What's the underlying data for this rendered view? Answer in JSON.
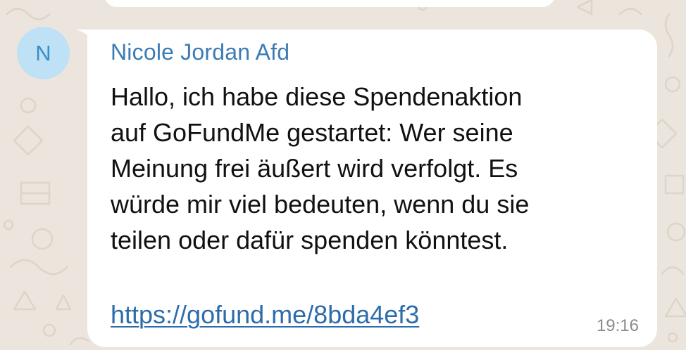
{
  "chat": {
    "background_color": "#ece5dd",
    "bubble_color": "#ffffff"
  },
  "message": {
    "avatar_initial": "N",
    "avatar_bg": "#bfe1f5",
    "avatar_fg": "#3a8ec8",
    "sender_name": "Nicole Jordan Afd",
    "sender_color": "#3c7bb5",
    "text": "Hallo, ich habe diese Spendenaktion\nauf GoFundMe gestartet: Wer seine\nMeinung frei äußert wird verfolgt. Es\nwürde mir viel bedeuten, wenn du sie\nteilen oder dafür spenden könntest.",
    "link": "https://gofund.me/8bda4ef3",
    "link_color": "#2d6cab",
    "time": "19:16"
  }
}
